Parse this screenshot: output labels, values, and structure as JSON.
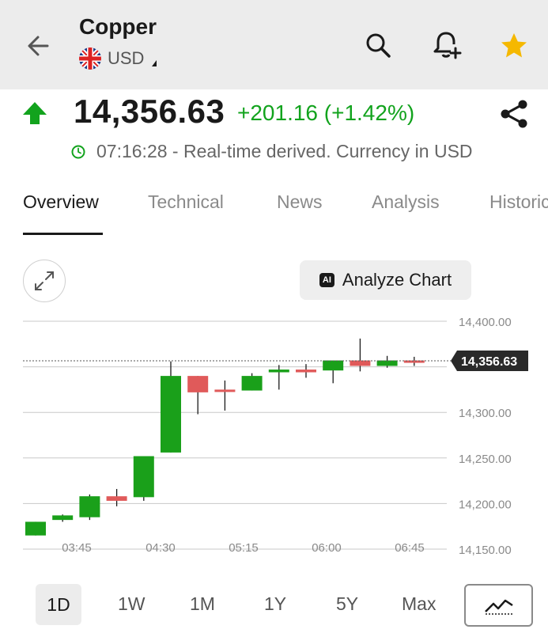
{
  "header": {
    "title": "Copper",
    "currency": "USD",
    "back_icon": "arrow-left-icon",
    "search_icon": "search-icon",
    "alert_icon": "bell-plus-icon",
    "favorite_icon": "star-icon",
    "favorite_color": "#f5b800"
  },
  "quote": {
    "price": "14,356.63",
    "change": "+201.16 (+1.42%)",
    "direction_icon": "up-arrow-icon",
    "status": "07:16:28 - Real-time derived. Currency in USD",
    "up_color": "#12a31d"
  },
  "tabs": [
    {
      "label": "Overview"
    },
    {
      "label": "Technical"
    },
    {
      "label": "News"
    },
    {
      "label": "Analysis"
    },
    {
      "label": "Historic"
    }
  ],
  "chart_controls": {
    "analyze_badge": "AI",
    "analyze_label": "Analyze Chart"
  },
  "ranges": {
    "items": [
      "1D",
      "1W",
      "1M",
      "1Y",
      "5Y",
      "Max"
    ],
    "selected": "1D"
  },
  "chart_data": {
    "type": "candlestick",
    "y_ticks": [
      "14,400.00",
      "14,300.00",
      "14,250.00",
      "14,200.00",
      "14,150.00"
    ],
    "ylim": [
      14150,
      14400
    ],
    "x_ticks": [
      "03:45",
      "04:30",
      "05:15",
      "06:00",
      "06:45"
    ],
    "current_label": "14,356.63",
    "current_value": 14356.63,
    "up_color": "#1aa01a",
    "down_color": "#e05a5a",
    "candles": [
      {
        "o": 14165,
        "h": 14180,
        "l": 14165,
        "c": 14180
      },
      {
        "o": 14182,
        "h": 14188,
        "l": 14180,
        "c": 14187
      },
      {
        "o": 14185,
        "h": 14210,
        "l": 14182,
        "c": 14208
      },
      {
        "o": 14208,
        "h": 14216,
        "l": 14197,
        "c": 14203
      },
      {
        "o": 14207,
        "h": 14252,
        "l": 14203,
        "c": 14252
      },
      {
        "o": 14256,
        "h": 14356,
        "l": 14256,
        "c": 14340
      },
      {
        "o": 14340,
        "h": 14340,
        "l": 14298,
        "c": 14322
      },
      {
        "o": 14325,
        "h": 14335,
        "l": 14302,
        "c": 14324
      },
      {
        "o": 14324,
        "h": 14343,
        "l": 14324,
        "c": 14340
      },
      {
        "o": 14344,
        "h": 14352,
        "l": 14325,
        "c": 14347
      },
      {
        "o": 14347,
        "h": 14353,
        "l": 14338,
        "c": 14344
      },
      {
        "o": 14346,
        "h": 14357,
        "l": 14332,
        "c": 14357
      },
      {
        "o": 14357,
        "h": 14381,
        "l": 14345,
        "c": 14351
      },
      {
        "o": 14351,
        "h": 14362,
        "l": 14349,
        "c": 14357
      },
      {
        "o": 14357,
        "h": 14361,
        "l": 14351,
        "c": 14355
      }
    ]
  }
}
